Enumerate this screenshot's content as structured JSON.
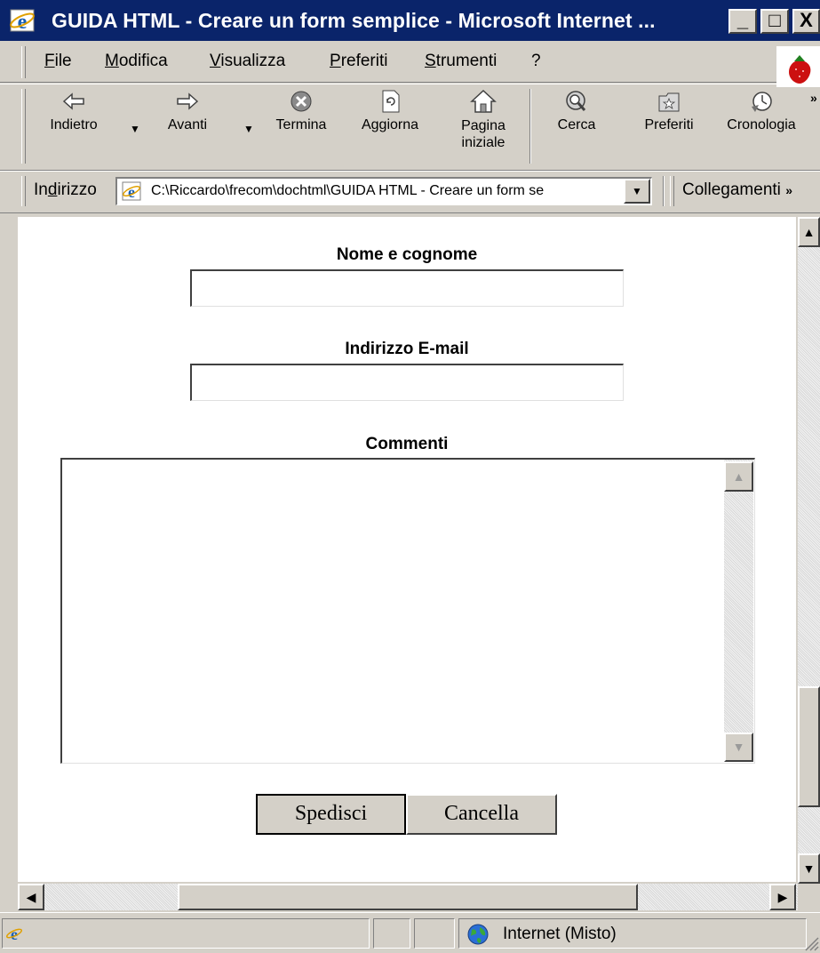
{
  "window": {
    "title": "GUIDA HTML - Creare un form semplice - Microsoft Internet ...",
    "title_bar_color": "#0a246a",
    "controls": {
      "minimize": "_",
      "maximize": "□",
      "close": "X"
    }
  },
  "menu": {
    "items": [
      {
        "label": "File",
        "icon": ""
      },
      {
        "label": "Modifica"
      },
      {
        "label": "Visualizza"
      },
      {
        "label": "Preferiti"
      },
      {
        "label": "Strumenti"
      },
      {
        "label": "?"
      }
    ]
  },
  "toolbar": {
    "buttons": [
      {
        "label": "Indietro",
        "icon": "back-arrow-icon"
      },
      {
        "label": "Avanti",
        "icon": "forward-arrow-icon"
      },
      {
        "label": "Termina",
        "icon": "stop-icon"
      },
      {
        "label": "Aggiorna",
        "icon": "refresh-icon"
      },
      {
        "label": "Pagina iniziale",
        "icon": "home-icon"
      },
      {
        "label": "Cerca",
        "icon": "search-icon"
      },
      {
        "label": "Preferiti",
        "icon": "favorites-icon"
      },
      {
        "label": "Cronologia",
        "icon": "history-icon"
      }
    ]
  },
  "address": {
    "label": "Indirizzo",
    "value": "C:\\Riccardo\\frecom\\dochtml\\GUIDA HTML - Creare un form se",
    "links_label": "Collegamenti"
  },
  "form": {
    "name_label": "Nome e cognome",
    "name_value": "",
    "email_label": "Indirizzo E-mail",
    "email_value": "",
    "comments_label": "Commenti",
    "comments_value": "",
    "submit_label": "Spedisci",
    "reset_label": "Cancella"
  },
  "status": {
    "zone": "Internet (Misto)"
  }
}
